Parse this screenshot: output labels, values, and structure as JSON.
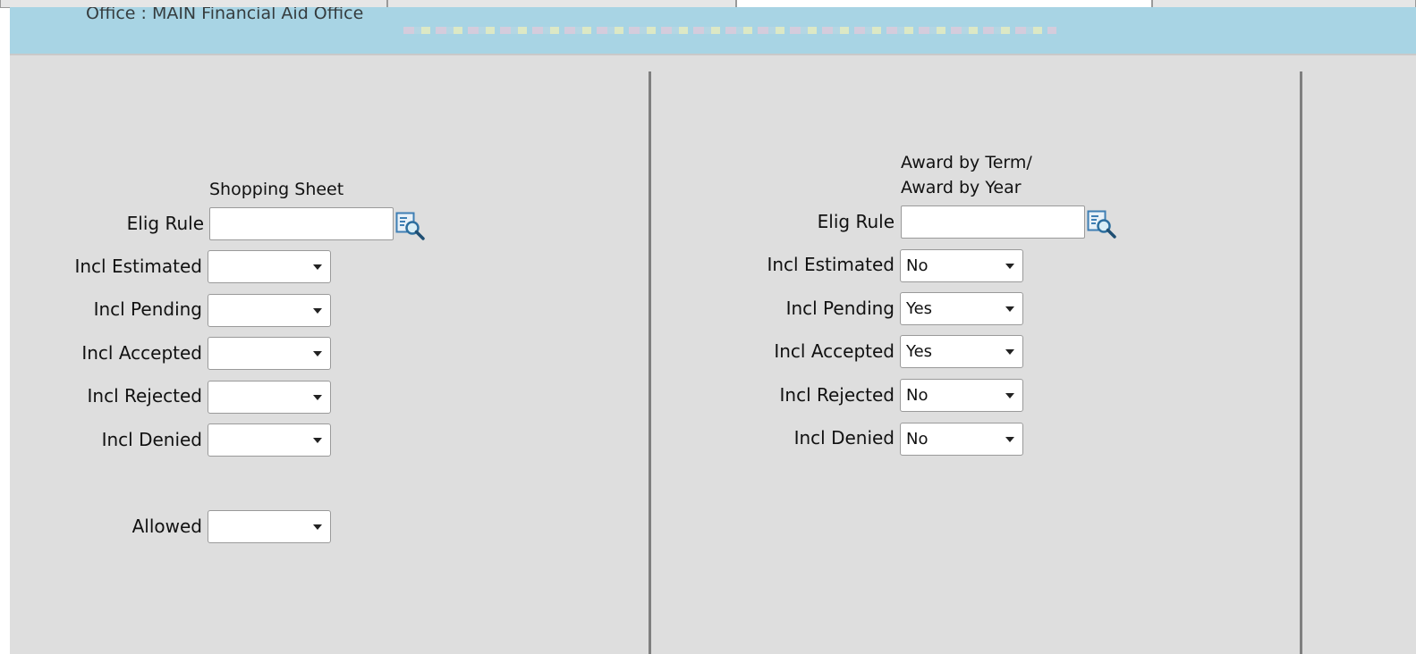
{
  "banner": {
    "text": "Office : MAIN Financial Aid Office"
  },
  "left_section": {
    "header": "Shopping Sheet",
    "elig_rule_label": "Elig Rule",
    "elig_rule_value": "",
    "selects": [
      {
        "label": "Incl Estimated",
        "value": ""
      },
      {
        "label": "Incl Pending",
        "value": ""
      },
      {
        "label": "Incl Accepted",
        "value": ""
      },
      {
        "label": "Incl Rejected",
        "value": ""
      },
      {
        "label": "Incl Denied",
        "value": ""
      }
    ],
    "allowed": {
      "label": "Allowed",
      "value": ""
    }
  },
  "right_section": {
    "header_line1": "Award by Term/",
    "header_line2": "Award by Year",
    "elig_rule_label": "Elig Rule",
    "elig_rule_value": "",
    "selects": [
      {
        "label": "Incl Estimated",
        "value": "No"
      },
      {
        "label": "Incl Pending",
        "value": "Yes"
      },
      {
        "label": "Incl Accepted",
        "value": "Yes"
      },
      {
        "label": "Incl Rejected",
        "value": "No"
      },
      {
        "label": "Incl Denied",
        "value": "No"
      }
    ]
  },
  "icons": {
    "lookup": "lookup-search-icon",
    "dropdown": "chevron-down-icon"
  },
  "colors": {
    "banner": "#a8d4e4",
    "panel": "#dedede",
    "separator": "#7f7f7f"
  }
}
